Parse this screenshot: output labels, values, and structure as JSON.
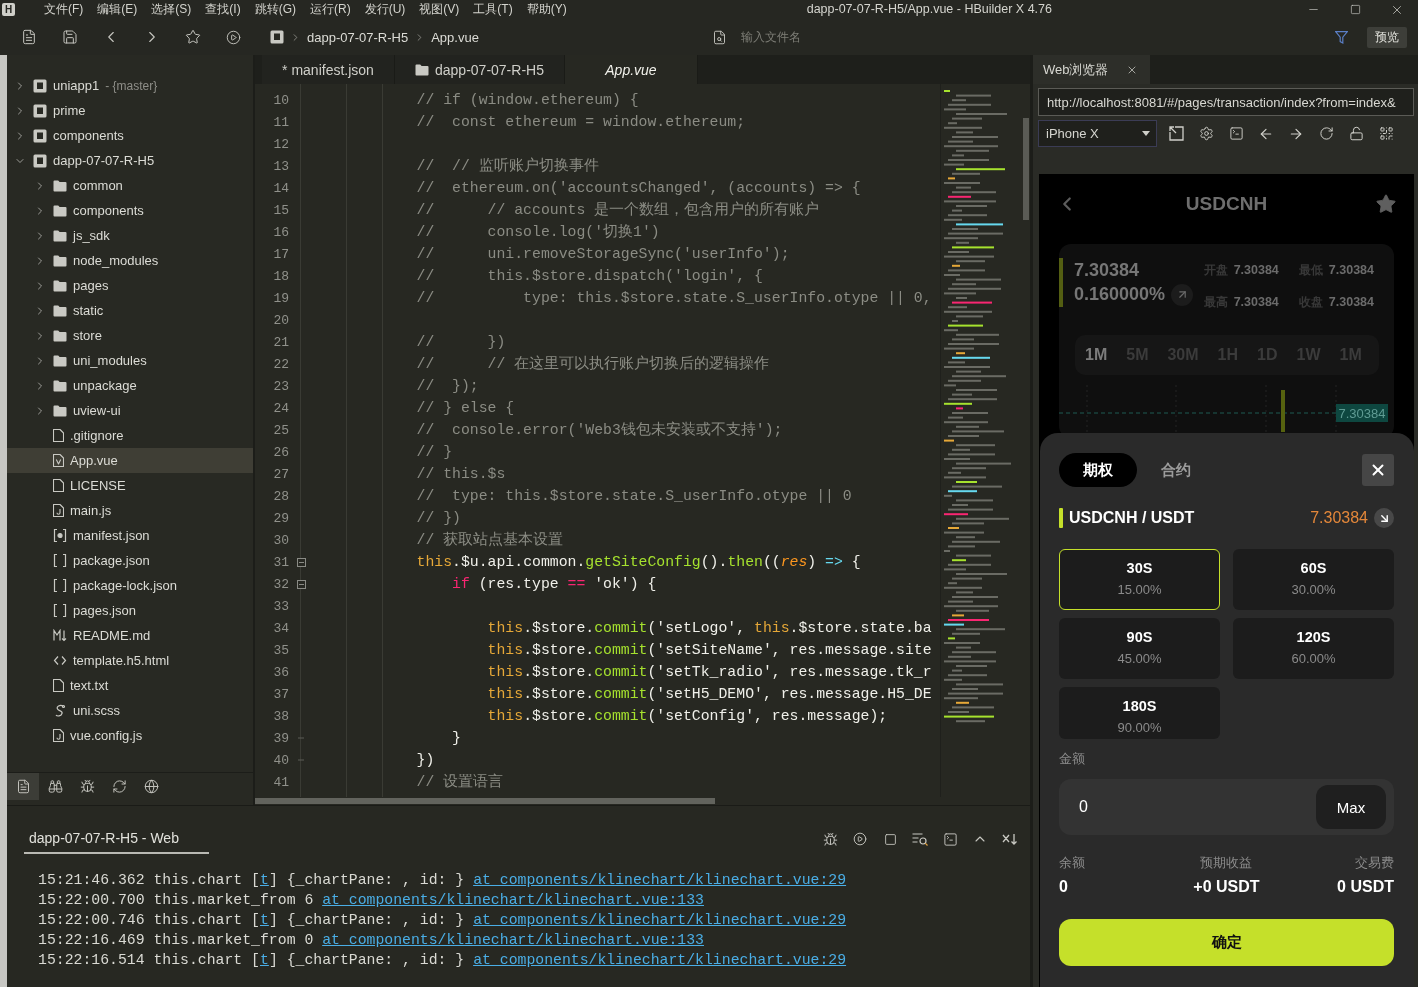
{
  "window": {
    "logo": "H",
    "menu": [
      "文件(F)",
      "编辑(E)",
      "选择(S)",
      "查找(I)",
      "跳转(G)",
      "运行(R)",
      "发行(U)",
      "视图(V)",
      "工具(T)",
      "帮助(Y)"
    ],
    "title": "dapp-07-07-R-H5/App.vue - HBuilder X 4.76"
  },
  "toolbar": {
    "breadcrumb": [
      "dapp-07-07-R-H5",
      "App.vue"
    ],
    "search": {
      "placeholder": "输入文件名"
    },
    "preview_button": "预览"
  },
  "sidebar": {
    "tree": [
      {
        "label": "uniapp1",
        "suffix": "- {master}",
        "kind": "project",
        "expanded": false,
        "selected": false
      },
      {
        "label": "prime",
        "kind": "project",
        "expanded": false,
        "selected": false
      },
      {
        "label": "components",
        "kind": "project",
        "expanded": false,
        "selected": false
      },
      {
        "label": "dapp-07-07-R-H5",
        "kind": "project",
        "expanded": true,
        "selected": false,
        "children": [
          {
            "label": "common",
            "kind": "folder",
            "expanded": false,
            "selected": false
          },
          {
            "label": "components",
            "kind": "folder",
            "expanded": false,
            "selected": false
          },
          {
            "label": "js_sdk",
            "kind": "folder",
            "expanded": false,
            "selected": false
          },
          {
            "label": "node_modules",
            "kind": "folder",
            "expanded": false,
            "selected": false
          },
          {
            "label": "pages",
            "kind": "folder",
            "expanded": false,
            "selected": false
          },
          {
            "label": "static",
            "kind": "folder",
            "expanded": false,
            "selected": false
          },
          {
            "label": "store",
            "kind": "folder",
            "expanded": false,
            "selected": false
          },
          {
            "label": "uni_modules",
            "kind": "folder",
            "expanded": false,
            "selected": false
          },
          {
            "label": "unpackage",
            "kind": "folder",
            "expanded": false,
            "selected": false
          },
          {
            "label": "uview-ui",
            "kind": "folder",
            "expanded": false,
            "selected": false
          },
          {
            "label": ".gitignore",
            "kind": "file",
            "selected": false
          },
          {
            "label": "App.vue",
            "kind": "vue",
            "selected": true
          },
          {
            "label": "LICENSE",
            "kind": "file",
            "selected": false
          },
          {
            "label": "main.js",
            "kind": "js",
            "selected": false
          },
          {
            "label": "manifest.json",
            "kind": "manifest",
            "selected": false
          },
          {
            "label": "package.json",
            "kind": "json",
            "selected": false
          },
          {
            "label": "package-lock.json",
            "kind": "json",
            "selected": false
          },
          {
            "label": "pages.json",
            "kind": "json",
            "selected": false
          },
          {
            "label": "README.md",
            "kind": "markdown",
            "selected": false
          },
          {
            "label": "template.h5.html",
            "kind": "html",
            "selected": false
          },
          {
            "label": "text.txt",
            "kind": "file",
            "selected": false
          },
          {
            "label": "uni.scss",
            "kind": "scss",
            "selected": false
          },
          {
            "label": "vue.config.js",
            "kind": "js",
            "selected": false
          }
        ]
      }
    ],
    "panel_tabs": [
      {
        "selected": true
      },
      {
        "selected": false
      },
      {
        "selected": false
      },
      {
        "selected": false
      },
      {
        "selected": false
      }
    ]
  },
  "editor": {
    "tabs": [
      {
        "label": "* manifest.json",
        "kind": "file",
        "selected": false
      },
      {
        "label": "dapp-07-07-R-H5",
        "kind": "folder",
        "selected": false
      },
      {
        "label": "App.vue",
        "kind": "file",
        "selected": true
      }
    ],
    "lines": [
      {
        "number": "10",
        "kind": "code",
        "tokens": [
          {
            "kind": "comment",
            "text": "\t\t\t// if (window.ethereum) {"
          }
        ]
      },
      {
        "number": "11",
        "kind": "code",
        "tokens": [
          {
            "kind": "comment",
            "text": "\t\t\t//  const ethereum = window.ethereum;"
          }
        ]
      },
      {
        "number": "12",
        "kind": "code"
      },
      {
        "number": "13",
        "kind": "code",
        "tokens": [
          {
            "kind": "comment",
            "text": "\t\t\t//  // 监听账户切换事件"
          }
        ]
      },
      {
        "number": "14",
        "kind": "code",
        "tokens": [
          {
            "kind": "comment",
            "text": "\t\t\t//  ethereum.on('accountsChanged', (accounts) => {"
          }
        ]
      },
      {
        "number": "15",
        "kind": "code",
        "tokens": [
          {
            "kind": "comment",
            "text": "\t\t\t//      // accounts 是一个数组，包含用户的所有账户"
          }
        ]
      },
      {
        "number": "16",
        "kind": "code",
        "tokens": [
          {
            "kind": "comment",
            "text": "\t\t\t//      console.log('切换1')"
          }
        ]
      },
      {
        "number": "17",
        "kind": "code",
        "tokens": [
          {
            "kind": "comment",
            "text": "\t\t\t//      uni.removeStorageSync('userInfo');"
          }
        ]
      },
      {
        "number": "18",
        "kind": "code",
        "tokens": [
          {
            "kind": "comment",
            "text": "\t\t\t//      this.$store.dispatch('login', {"
          }
        ]
      },
      {
        "number": "19",
        "kind": "code",
        "tokens": [
          {
            "kind": "comment",
            "text": "\t\t\t//          type: this.$store.state.S_userInfo.otype || 0,"
          }
        ]
      },
      {
        "number": "20",
        "kind": "code"
      },
      {
        "number": "21",
        "kind": "code",
        "tokens": [
          {
            "kind": "comment",
            "text": "\t\t\t//      })"
          }
        ]
      },
      {
        "number": "22",
        "kind": "code",
        "tokens": [
          {
            "kind": "comment",
            "text": "\t\t\t//      // 在这里可以执行账户切换后的逻辑操作"
          }
        ]
      },
      {
        "number": "23",
        "kind": "code",
        "tokens": [
          {
            "kind": "comment",
            "text": "\t\t\t//  });"
          }
        ]
      },
      {
        "number": "24",
        "kind": "code",
        "tokens": [
          {
            "kind": "comment",
            "text": "\t\t\t// } else {"
          }
        ]
      },
      {
        "number": "25",
        "kind": "code",
        "tokens": [
          {
            "kind": "comment",
            "text": "\t\t\t//  console.error('Web3钱包未安装或不支持');"
          }
        ]
      },
      {
        "number": "26",
        "kind": "code",
        "tokens": [
          {
            "kind": "comment",
            "text": "\t\t\t// }"
          }
        ]
      },
      {
        "number": "27",
        "kind": "code",
        "tokens": [
          {
            "kind": "comment",
            "text": "\t\t\t// this.$s"
          }
        ]
      },
      {
        "number": "28",
        "kind": "code",
        "tokens": [
          {
            "kind": "comment",
            "text": "\t\t\t//  type: this.$store.state.S_userInfo.otype || 0"
          }
        ]
      },
      {
        "number": "29",
        "kind": "code",
        "tokens": [
          {
            "kind": "comment",
            "text": "\t\t\t// })"
          }
        ]
      },
      {
        "number": "30",
        "kind": "code",
        "tokens": [
          {
            "kind": "comment",
            "text": "\t\t\t// 获取站点基本设置"
          }
        ]
      },
      {
        "number": "31",
        "kind": "fold_start",
        "expanded": true,
        "tokens": [
          {
            "kind": "variable",
            "text": "\t\t\tthis"
          },
          {
            "kind": "plain",
            "text": ".$u.api.common."
          },
          {
            "kind": "function",
            "text": "getSiteConfig"
          },
          {
            "kind": "plain",
            "text": "()."
          },
          {
            "kind": "function",
            "text": "then"
          },
          {
            "kind": "plain",
            "text": "(("
          },
          {
            "kind": "parameter",
            "text": "res"
          },
          {
            "kind": "plain",
            "text": ") "
          },
          {
            "kind": "storage",
            "text": "=>"
          },
          {
            "kind": "plain",
            "text": " {"
          }
        ]
      },
      {
        "number": "32",
        "kind": "fold_start",
        "expanded": true,
        "tokens": [
          {
            "kind": "keyword",
            "text": "\t\t\t\tif"
          },
          {
            "kind": "plain",
            "text": " (res.type "
          },
          {
            "kind": "keyword",
            "text": "=="
          },
          {
            "kind": "plain",
            "text": " 'ok') {"
          }
        ]
      },
      {
        "number": "33",
        "kind": "code"
      },
      {
        "number": "34",
        "kind": "code",
        "tokens": [
          {
            "kind": "variable",
            "text": "\t\t\t\t\tthis"
          },
          {
            "kind": "plain",
            "text": ".$store."
          },
          {
            "kind": "function",
            "text": "commit"
          },
          {
            "kind": "plain",
            "text": "('setLogo', "
          },
          {
            "kind": "variable",
            "text": "this"
          },
          {
            "kind": "plain",
            "text": ".$store.state.ba"
          }
        ]
      },
      {
        "number": "35",
        "kind": "code",
        "tokens": [
          {
            "kind": "variable",
            "text": "\t\t\t\t\tthis"
          },
          {
            "kind": "plain",
            "text": ".$store."
          },
          {
            "kind": "function",
            "text": "commit"
          },
          {
            "kind": "plain",
            "text": "('setSiteName', res.message.site"
          }
        ]
      },
      {
        "number": "36",
        "kind": "code",
        "tokens": [
          {
            "kind": "variable",
            "text": "\t\t\t\t\tthis"
          },
          {
            "kind": "plain",
            "text": ".$store."
          },
          {
            "kind": "function",
            "text": "commit"
          },
          {
            "kind": "plain",
            "text": "('setTk_radio', res.message.tk_r"
          }
        ]
      },
      {
        "number": "37",
        "kind": "code",
        "tokens": [
          {
            "kind": "variable",
            "text": "\t\t\t\t\tthis"
          },
          {
            "kind": "plain",
            "text": ".$store."
          },
          {
            "kind": "function",
            "text": "commit"
          },
          {
            "kind": "plain",
            "text": "('setH5_DEMO', res.message.H5_DE"
          }
        ]
      },
      {
        "number": "38",
        "kind": "code",
        "tokens": [
          {
            "kind": "variable",
            "text": "\t\t\t\t\tthis"
          },
          {
            "kind": "plain",
            "text": ".$store."
          },
          {
            "kind": "function",
            "text": "commit"
          },
          {
            "kind": "plain",
            "text": "('setConfig', res.message);"
          }
        ]
      },
      {
        "number": "39",
        "kind": "fold_end",
        "tokens": [
          {
            "kind": "plain",
            "text": "\t\t\t\t}"
          }
        ]
      },
      {
        "number": "40",
        "kind": "fold_end",
        "tokens": [
          {
            "kind": "plain",
            "text": "\t\t\t})"
          }
        ]
      },
      {
        "number": "41",
        "kind": "code",
        "tokens": [
          {
            "kind": "comment",
            "text": "\t\t\t// 设置语言"
          }
        ]
      }
    ]
  },
  "browser": {
    "tabs": [
      {
        "label": "Web浏览器",
        "selected": true
      }
    ],
    "url": "http://localhost:8081/#/pages/transaction/index?from=index&",
    "device": "iPhone X",
    "page": {
      "title": "USDCNH",
      "price": "7.30384",
      "change": "0.160000%",
      "stats": [
        {
          "label": "开盘",
          "value": "7.30384"
        },
        {
          "label": "最低",
          "value": "7.30384"
        },
        {
          "label": "最高",
          "value": "7.30384"
        },
        {
          "label": "收盘",
          "value": "7.30384"
        }
      ],
      "intervals": [
        {
          "label": "1M",
          "selected": true
        },
        {
          "label": "5M",
          "selected": false
        },
        {
          "label": "30M",
          "selected": false
        },
        {
          "label": "1H",
          "selected": false
        },
        {
          "label": "1D",
          "selected": false
        },
        {
          "label": "1W",
          "selected": false
        },
        {
          "label": "1M",
          "selected": false
        }
      ],
      "chart": {
        "price_tag": "7.30384"
      },
      "sheet": {
        "tabs": [
          {
            "label": "期权",
            "selected": true
          },
          {
            "label": "合约",
            "selected": false
          }
        ],
        "pair": "USDCNH / USDT",
        "pair_price": "7.30384",
        "options": [
          {
            "duration": "30S",
            "rate": "15.00%",
            "selected": true
          },
          {
            "duration": "60S",
            "rate": "30.00%",
            "selected": false
          },
          {
            "duration": "90S",
            "rate": "45.00%",
            "selected": false
          },
          {
            "duration": "120S",
            "rate": "60.00%",
            "selected": false
          },
          {
            "duration": "180S",
            "rate": "90.00%",
            "selected": false
          }
        ],
        "amount": {
          "label": "金额",
          "value": "0"
        },
        "max_button": "Max",
        "summary": [
          {
            "label": "余额",
            "value": "0"
          },
          {
            "label": "预期收益",
            "value": "+0 USDT"
          },
          {
            "label": "交易费",
            "value": "0 USDT"
          }
        ],
        "confirm_button": "确定"
      }
    }
  },
  "console": {
    "tabs": [
      {
        "label": "dapp-07-07-R-H5 - Web",
        "selected": true
      }
    ],
    "lines": [
      {
        "segments": [
          {
            "kind": "text",
            "text": "15:21:46.362 this.chart ["
          },
          {
            "kind": "link",
            "text": "t"
          },
          {
            "kind": "text",
            "text": "] {_chartPane: , id: } "
          },
          {
            "kind": "link",
            "text": "at components/klinechart/klinechart.vue:29"
          }
        ]
      },
      {
        "segments": [
          {
            "kind": "text",
            "text": "15:22:00.700 this.market_from 6 "
          },
          {
            "kind": "link",
            "text": "at components/klinechart/klinechart.vue:133"
          }
        ]
      },
      {
        "segments": [
          {
            "kind": "text",
            "text": "15:22:00.746 this.chart ["
          },
          {
            "kind": "link",
            "text": "t"
          },
          {
            "kind": "text",
            "text": "] {_chartPane: , id: } "
          },
          {
            "kind": "link",
            "text": "at components/klinechart/klinechart.vue:29"
          }
        ]
      },
      {
        "segments": [
          {
            "kind": "text",
            "text": "15:22:16.469 this.market_from 0 "
          },
          {
            "kind": "link",
            "text": "at components/klinechart/klinechart.vue:133"
          }
        ]
      },
      {
        "segments": [
          {
            "kind": "text",
            "text": "15:22:16.514 this.chart ["
          },
          {
            "kind": "link",
            "text": "t"
          },
          {
            "kind": "text",
            "text": "] {_chartPane: , id: } "
          },
          {
            "kind": "link",
            "text": "at components/klinechart/klinechart.vue:29"
          }
        ]
      }
    ]
  }
}
